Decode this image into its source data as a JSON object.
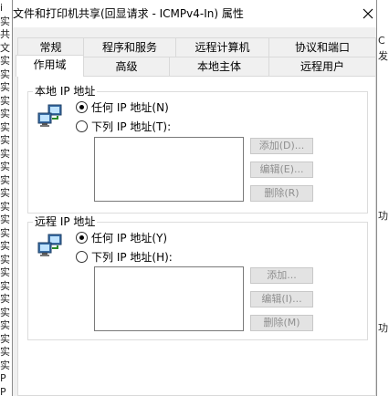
{
  "window": {
    "title": "文件和打印机共享(回显请求 - ICMPv4-In) 属性"
  },
  "tabs_row1": [
    "常规",
    "程序和服务",
    "远程计算机",
    "协议和端口"
  ],
  "tabs_row2": [
    "作用域",
    "高级",
    "本地主体",
    "远程用户"
  ],
  "active_tab": "作用域",
  "local_ip": {
    "group_title": "本地 IP 地址",
    "option_any": "任何 IP 地址(N)",
    "option_list": "下列 IP 地址(T):",
    "selected": "any",
    "add_button": "添加(D)...",
    "edit_button": "编辑(E)...",
    "remove_button": "删除(R)"
  },
  "remote_ip": {
    "group_title": "远程 IP 地址",
    "option_any": "任何 IP 地址(Y)",
    "option_list": "下列 IP 地址(H):",
    "selected": "any",
    "add_button": "添加...",
    "edit_button": "编辑(I)...",
    "remove_button": "删除(M)"
  },
  "background_left": [
    "i",
    "实",
    "共",
    "文",
    "实",
    "实",
    "实",
    "实",
    "实",
    "实",
    "实",
    "实",
    "实",
    "实",
    "实",
    "实",
    "实",
    "实",
    "实",
    "实",
    "实",
    "实",
    "实",
    "实",
    "实",
    "实",
    "实",
    "实",
    "P",
    "P"
  ],
  "background_right": [
    "",
    "C",
    "发",
    "",
    "",
    "",
    "",
    "",
    "",
    "",
    "",
    "",
    "功",
    "",
    "",
    "",
    "",
    "",
    "",
    "功",
    "",
    "",
    "",
    "",
    ""
  ]
}
